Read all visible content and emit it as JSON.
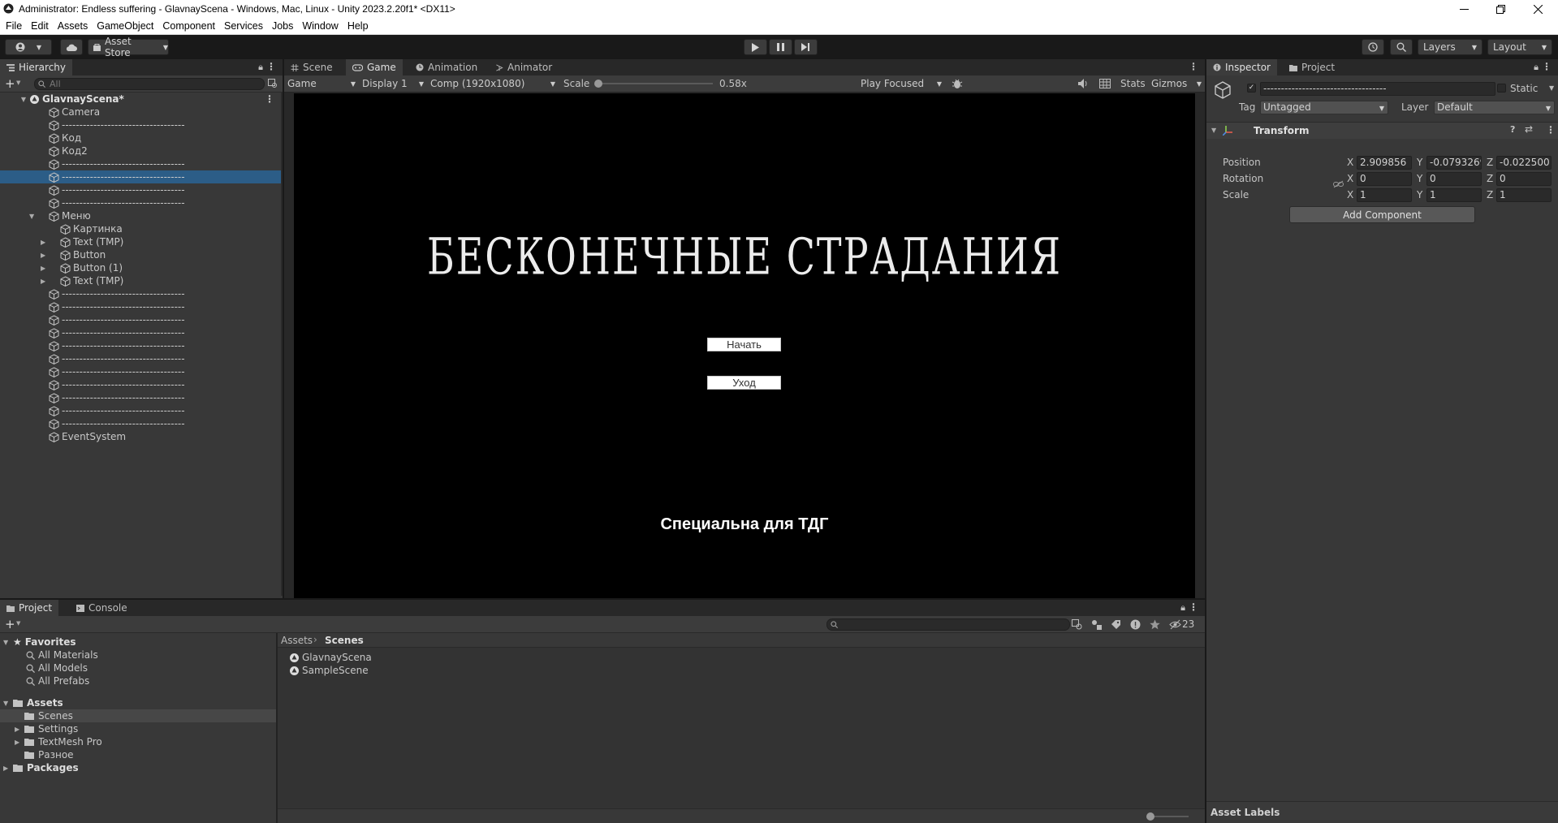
{
  "window": {
    "title": "Administrator: Endless suffering - GlavnayScena - Windows, Mac, Linux - Unity 2023.2.20f1* <DX11>"
  },
  "menu": [
    "File",
    "Edit",
    "Assets",
    "GameObject",
    "Component",
    "Services",
    "Jobs",
    "Window",
    "Help"
  ],
  "toolbar": {
    "asset_store": "Asset Store",
    "layers": "Layers",
    "layout": "Layout"
  },
  "hierarchy": {
    "tab": "Hierarchy",
    "search_placeholder": "All",
    "scene": "GlavnayScena*",
    "rows": [
      {
        "label": "Camera",
        "indent": 1,
        "fold": ""
      },
      {
        "label": "-----------------------------------",
        "indent": 1,
        "fold": ""
      },
      {
        "label": "Код",
        "indent": 1,
        "fold": ""
      },
      {
        "label": "Код2",
        "indent": 1,
        "fold": ""
      },
      {
        "label": "-----------------------------------",
        "indent": 1,
        "fold": ""
      },
      {
        "label": "-----------------------------------",
        "indent": 1,
        "fold": "",
        "selected": true
      },
      {
        "label": "-----------------------------------",
        "indent": 1,
        "fold": ""
      },
      {
        "label": "-----------------------------------",
        "indent": 1,
        "fold": ""
      },
      {
        "label": "Меню",
        "indent": 1,
        "fold": "▼"
      },
      {
        "label": "Картинка",
        "indent": 2,
        "fold": ""
      },
      {
        "label": "Text (TMP)",
        "indent": 2,
        "fold": "▶"
      },
      {
        "label": "Button",
        "indent": 2,
        "fold": "▶"
      },
      {
        "label": "Button (1)",
        "indent": 2,
        "fold": "▶"
      },
      {
        "label": "Text (TMP)",
        "indent": 2,
        "fold": "▶"
      },
      {
        "label": "-----------------------------------",
        "indent": 1,
        "fold": ""
      },
      {
        "label": "-----------------------------------",
        "indent": 1,
        "fold": ""
      },
      {
        "label": "-----------------------------------",
        "indent": 1,
        "fold": ""
      },
      {
        "label": "-----------------------------------",
        "indent": 1,
        "fold": ""
      },
      {
        "label": "-----------------------------------",
        "indent": 1,
        "fold": ""
      },
      {
        "label": "-----------------------------------",
        "indent": 1,
        "fold": ""
      },
      {
        "label": "-----------------------------------",
        "indent": 1,
        "fold": ""
      },
      {
        "label": "-----------------------------------",
        "indent": 1,
        "fold": ""
      },
      {
        "label": "-----------------------------------",
        "indent": 1,
        "fold": ""
      },
      {
        "label": "-----------------------------------",
        "indent": 1,
        "fold": ""
      },
      {
        "label": "-----------------------------------",
        "indent": 1,
        "fold": ""
      },
      {
        "label": "EventSystem",
        "indent": 1,
        "fold": ""
      }
    ]
  },
  "center": {
    "tabs": [
      "Scene",
      "Game",
      "Animation",
      "Animator"
    ],
    "game_dropdown": "Game",
    "display": "Display 1",
    "resolution": "Comp (1920x1080)",
    "scale_label": "Scale",
    "scale_value": "0.58x",
    "scale_level": 0.0,
    "play_mode": "Play Focused",
    "stats": "Stats",
    "gizmos": "Gizmos"
  },
  "game": {
    "title": "БЕСКОНЕЧНЫЕ СТРАДАНИЯ",
    "start": "Начать",
    "exit": "Уход",
    "credit": "Специальна для ТДГ"
  },
  "inspector": {
    "tabs": [
      "Inspector",
      "Project"
    ],
    "object_name": "-----------------------------------",
    "static_label": "Static",
    "tag_label": "Tag",
    "tag_value": "Untagged",
    "layer_label": "Layer",
    "layer_value": "Default",
    "component": "Transform",
    "rows": [
      {
        "label": "Position",
        "x": "2.909856",
        "y": "-0.0793269",
        "z": "-0.022500"
      },
      {
        "label": "Rotation",
        "x": "0",
        "y": "0",
        "z": "0"
      },
      {
        "label": "Scale",
        "x": "1",
        "y": "1",
        "z": "1"
      }
    ],
    "axis": [
      "X",
      "Y",
      "Z"
    ],
    "add_component": "Add Component",
    "asset_labels": "Asset Labels"
  },
  "project": {
    "tabs": [
      "Project",
      "Console"
    ],
    "hidden_count": "23",
    "favorites": "Favorites",
    "favorite_items": [
      "All Materials",
      "All Models",
      "All Prefabs"
    ],
    "assets": "Assets",
    "asset_folders": [
      {
        "label": "Scenes",
        "fold": "",
        "selected": true
      },
      {
        "label": "Settings",
        "fold": "▶"
      },
      {
        "label": "TextMesh Pro",
        "fold": "▶"
      },
      {
        "label": "Разное",
        "fold": ""
      }
    ],
    "packages": "Packages",
    "breadcrumb_root": "Assets",
    "breadcrumb_current": "Scenes",
    "files": [
      "GlavnayScena",
      "SampleScene"
    ]
  }
}
